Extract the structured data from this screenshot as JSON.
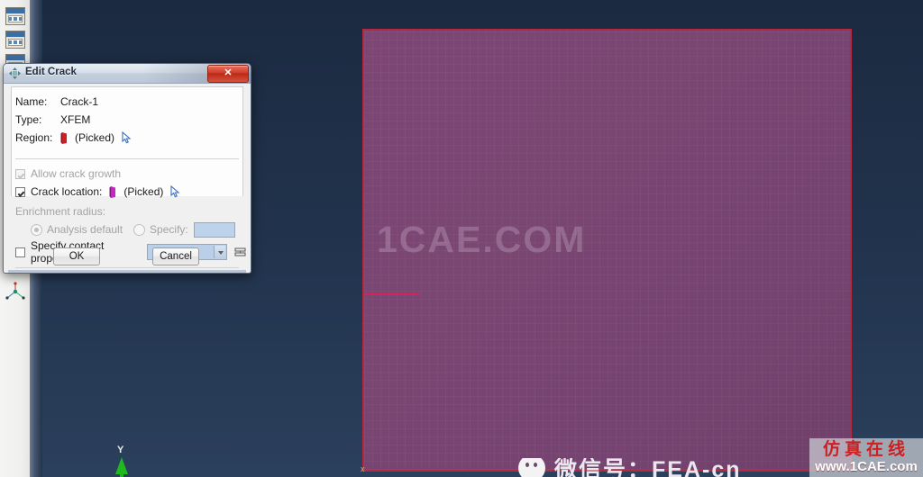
{
  "app": {
    "viewport_background": "#203650",
    "model_color": "#7a4672",
    "model_border_color": "#b3293f",
    "crack_line_color": "#d3255c"
  },
  "toolbar": {
    "icons": [
      {
        "name": "panel-icon-1"
      },
      {
        "name": "panel-icon-2"
      },
      {
        "name": "panel-icon-3"
      }
    ],
    "node_triad_icon": "node-triad-icon"
  },
  "viewport": {
    "watermark": "1CAE.COM",
    "axis": {
      "y_label": "Y"
    },
    "corner_marker": "x"
  },
  "wechat": {
    "text": "微信号：FEA-cn"
  },
  "logo": {
    "cn": "仿真在线",
    "url": "www.1CAE.com"
  },
  "dialog": {
    "title": "Edit Crack",
    "title_icon": "move-diamond-icon",
    "close_label": "✕",
    "fields": {
      "name_label": "Name:",
      "name_value": "Crack-1",
      "type_label": "Type:",
      "type_value": "XFEM",
      "region_label": "Region:",
      "region_value": "(Picked)",
      "region_icon": "crack-region-icon",
      "region_cursor_icon": "pick-cursor-icon"
    },
    "options": {
      "allow_crack_growth_label": "Allow crack growth",
      "allow_crack_growth_checked": true,
      "allow_crack_growth_enabled": false,
      "crack_location_label": "Crack location:",
      "crack_location_value": "(Picked)",
      "crack_location_checked": true,
      "crack_location_icon": "crack-location-icon",
      "crack_location_cursor_icon": "pick-cursor-icon",
      "enrichment_radius_label": "Enrichment radius:",
      "analysis_default_label": "Analysis default",
      "analysis_default_selected": true,
      "specify_label": "Specify:",
      "specify_selected": false,
      "specify_value": "",
      "specify_contact_property_label": "Specify contact property:",
      "specify_contact_property_checked": false,
      "contact_property_value": "",
      "contact_property_edit_icon": "edit-contact-property-icon"
    },
    "buttons": {
      "ok": "OK",
      "cancel": "Cancel"
    }
  }
}
